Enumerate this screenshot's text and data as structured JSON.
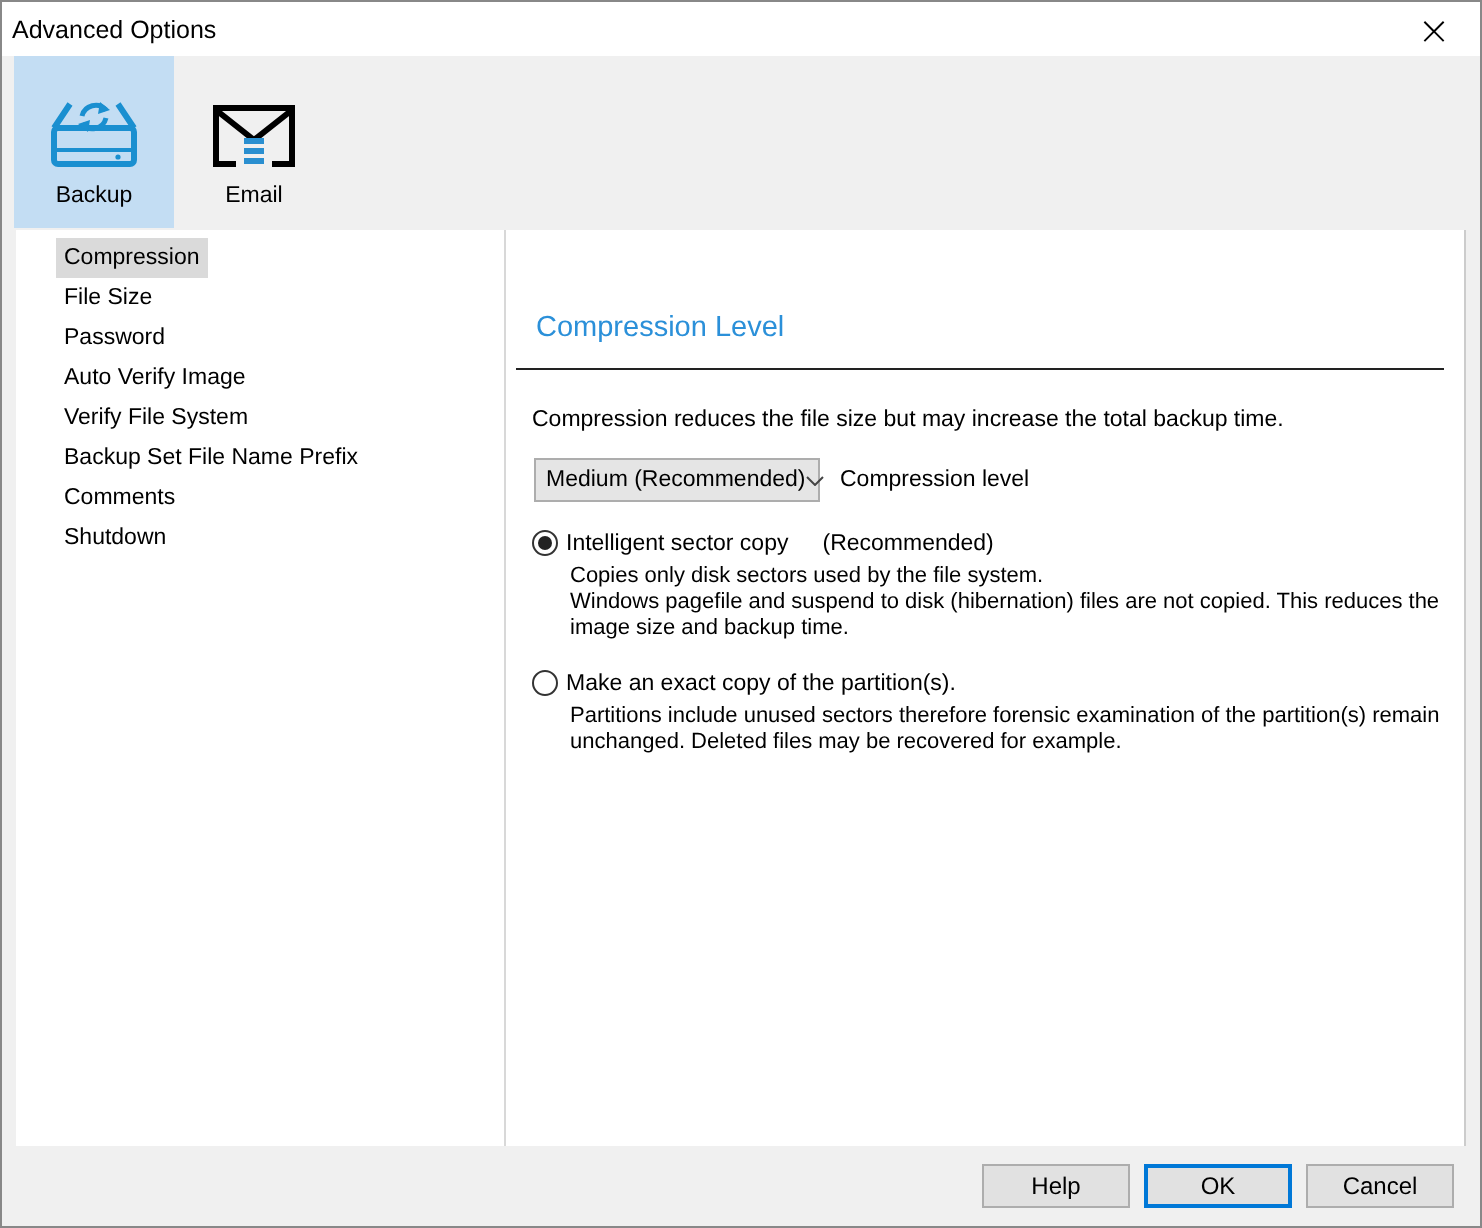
{
  "window": {
    "title": "Advanced Options",
    "close": "×"
  },
  "toolbar": [
    {
      "kind": "backup",
      "label": "Backup",
      "selected": true
    },
    {
      "kind": "email",
      "label": "Email",
      "selected": false
    }
  ],
  "sidebar": {
    "items": [
      {
        "label": "Compression",
        "selected": true
      },
      {
        "label": "File Size",
        "selected": false
      },
      {
        "label": "Password",
        "selected": false
      },
      {
        "label": "Auto Verify Image",
        "selected": false
      },
      {
        "label": "Verify File System",
        "selected": false
      },
      {
        "label": "Backup Set File Name Prefix",
        "selected": false
      },
      {
        "label": "Comments",
        "selected": false
      },
      {
        "label": "Shutdown",
        "selected": false
      }
    ]
  },
  "panel": {
    "heading": "Compression Level",
    "intro": "Compression reduces the file size but may increase the total backup time.",
    "dropdown": {
      "value": "Medium (Recommended)",
      "label": "Compression level"
    },
    "options": [
      {
        "label": "Intelligent sector copy",
        "note": "(Recommended)",
        "selected": true,
        "description": [
          "Copies only disk sectors used by the file system.",
          "Windows pagefile and suspend to disk (hibernation) files are not copied. This reduces the image size and backup time."
        ]
      },
      {
        "label": "Make an exact copy of the partition(s).",
        "selected": false,
        "description": [
          "Partitions include unused sectors therefore forensic examination of the partition(s) remain unchanged. Deleted files may be recovered for example."
        ]
      }
    ]
  },
  "buttons": [
    {
      "label": "Help",
      "default": false
    },
    {
      "label": "OK",
      "default": true
    },
    {
      "label": "Cancel",
      "default": false
    }
  ]
}
